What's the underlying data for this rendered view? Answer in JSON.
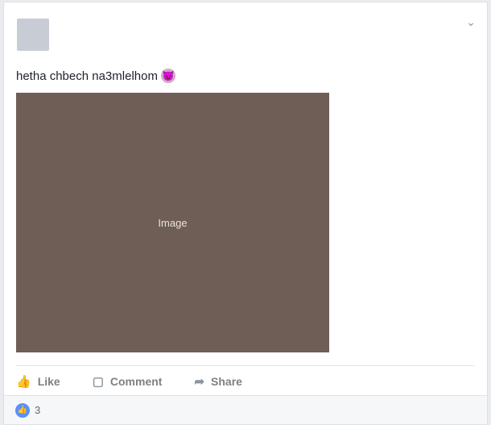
{
  "post": {
    "author_name": "",
    "timestamp": "",
    "text": "hetha chbech na3mlelhom",
    "emoji_icon": "smiling-devil-emoji",
    "options_icon": "chevron-down-icon"
  },
  "actions": [
    {
      "label": "Like",
      "icon": "thumbs-up-icon"
    },
    {
      "label": "Comment",
      "icon": "comment-bubble-icon"
    },
    {
      "label": "Share",
      "icon": "share-arrow-icon"
    }
  ],
  "reactions": {
    "icon": "like-reaction-icon",
    "count": "3"
  },
  "colors": {
    "accent": "#365899",
    "like_blue": "#5890ff",
    "background": "#e9ebee"
  }
}
